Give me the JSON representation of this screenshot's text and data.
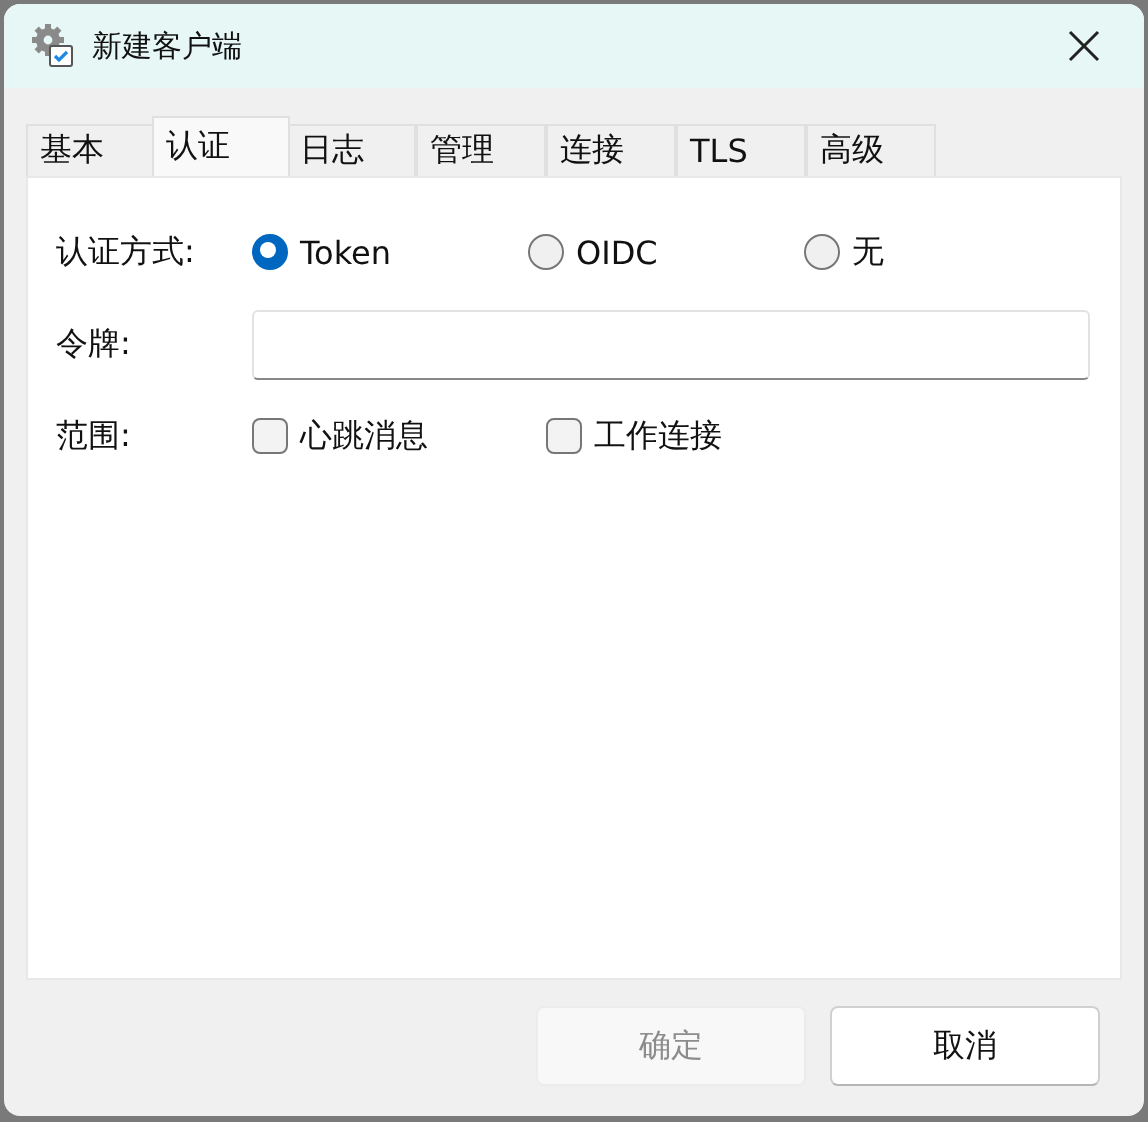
{
  "window": {
    "title": "新建客户端"
  },
  "tabs": [
    {
      "label": "基本",
      "selected": false
    },
    {
      "label": "认证",
      "selected": true
    },
    {
      "label": "日志",
      "selected": false
    },
    {
      "label": "管理",
      "selected": false
    },
    {
      "label": "连接",
      "selected": false
    },
    {
      "label": "TLS",
      "selected": false
    },
    {
      "label": "高级",
      "selected": false
    }
  ],
  "auth_method": {
    "label": "认证方式:",
    "options": [
      {
        "label": "Token",
        "selected": true
      },
      {
        "label": "OIDC",
        "selected": false
      },
      {
        "label": "无",
        "selected": false
      }
    ]
  },
  "token": {
    "label": "令牌:"
  },
  "scope": {
    "label": "范围:",
    "options": [
      {
        "label": "心跳消息",
        "checked": false
      },
      {
        "label": "工作连接",
        "checked": false
      }
    ]
  },
  "buttons": [
    {
      "label": "确定",
      "disabled": true
    },
    {
      "label": "取消",
      "disabled": false
    }
  ]
}
